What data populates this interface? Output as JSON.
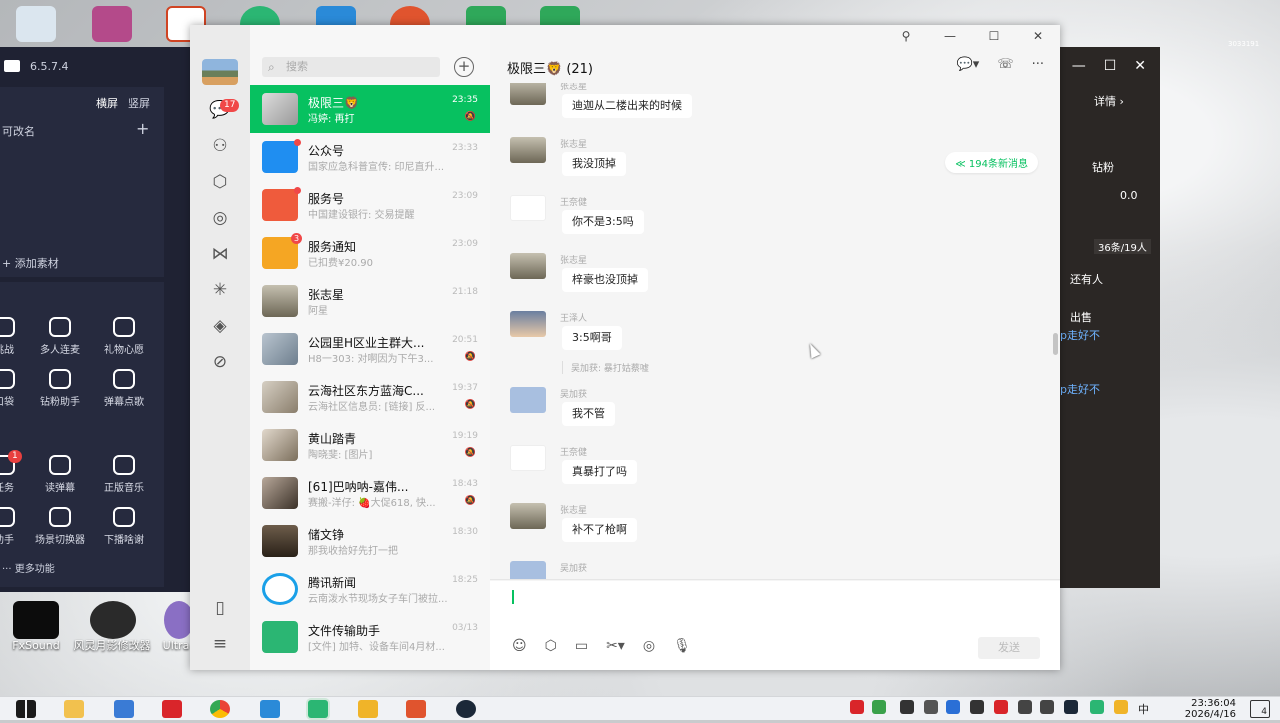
{
  "desktop": {
    "icons": [
      {
        "label": "FxSound"
      },
      {
        "label": "风灵月影修改器"
      },
      {
        "label": "Ultra"
      }
    ],
    "corner_text": "3033191"
  },
  "left_app": {
    "version": "6.5.7.4",
    "tab_landscape": "横屏",
    "tab_portrait": "竖屏",
    "rename_hint": "可改名",
    "add_material": "添加素材",
    "grid_items": [
      {
        "label": "挑战"
      },
      {
        "label": "多人连麦"
      },
      {
        "label": "礼物心愿"
      },
      {
        "label": "口袋"
      },
      {
        "label": "钻粉助手"
      },
      {
        "label": "弹幕点歌"
      },
      {
        "label": "任务",
        "badge": "1"
      },
      {
        "label": "读弹幕"
      },
      {
        "label": "正版音乐"
      },
      {
        "label": "助手"
      },
      {
        "label": "场景切换器"
      },
      {
        "label": "下播啥谢"
      }
    ],
    "more": "更多功能"
  },
  "right_app": {
    "detail_label": "详情",
    "fans": "钻粉",
    "stat": "0.0",
    "viewers": "36条/19人",
    "lines": [
      "还有人",
      "出售",
      "p走好不",
      "p走好不"
    ]
  },
  "wechat": {
    "nav": {
      "unread_badge": "17"
    },
    "search_placeholder": "搜索",
    "chats": [
      {
        "name": "极限三🦁",
        "preview": "冯婷: 再打",
        "time": "23:35",
        "active": true
      },
      {
        "name": "公众号",
        "preview": "国家应急科普宣传: 印尼直升...",
        "time": "23:33",
        "dot": true
      },
      {
        "name": "服务号",
        "preview": "中国建设银行: 交易提醒",
        "time": "23:09",
        "dot": true
      },
      {
        "name": "服务通知",
        "preview": "已扣费¥20.90",
        "time": "23:09",
        "badge": "3"
      },
      {
        "name": "张志星",
        "preview": "阿星",
        "time": "21:18"
      },
      {
        "name": "公园里H区业主群大...",
        "preview": "H8一303: 对啊因为下午3...",
        "time": "20:51"
      },
      {
        "name": "云海社区东方蓝海C...",
        "preview": "云海社区信息员: [链接] 反...",
        "time": "19:37"
      },
      {
        "name": "黄山踏青",
        "preview": "陶晓斐: [图片]",
        "time": "19:19"
      },
      {
        "name": "[61]巴呐呐-嘉伟...",
        "preview": "赛搬-洋仔: 🍓大促618, 快...",
        "time": "18:43"
      },
      {
        "name": "储文铮",
        "preview": "那我收拾好先打一把",
        "time": "18:30"
      },
      {
        "name": "腾讯新闻",
        "preview": "云南泼水节现场女子车门被拉...",
        "time": "18:25"
      },
      {
        "name": "文件传输助手",
        "preview": "[文件] 加特、设备车间4月材...",
        "time": "03/13"
      }
    ],
    "chat_title": "极限三🦁 (21)",
    "new_messages": "≪ 194条新消息",
    "messages": [
      {
        "sender": "张志星",
        "text": "迪迦从二楼出来的时候"
      },
      {
        "sender": "张志星",
        "text": "我没顶掉"
      },
      {
        "sender": "王奈健",
        "text": "你不是3:5吗"
      },
      {
        "sender": "张志星",
        "text": "梓豪也没顶掉"
      },
      {
        "sender": "王泽人",
        "text": "3:5啊哥",
        "quote": "吴加获: 暴打姑蔡嘘"
      },
      {
        "sender": "吴加获",
        "text": "我不管"
      },
      {
        "sender": "王奈健",
        "text": "真暴打了吗"
      },
      {
        "sender": "张志星",
        "text": "补不了枪啊"
      },
      {
        "sender": "吴加获",
        "text": ""
      }
    ],
    "send_label": "发送"
  },
  "taskbar": {
    "time": "23:36:04",
    "date": "2026/4/16",
    "ime": "中",
    "notification_count": "4"
  }
}
